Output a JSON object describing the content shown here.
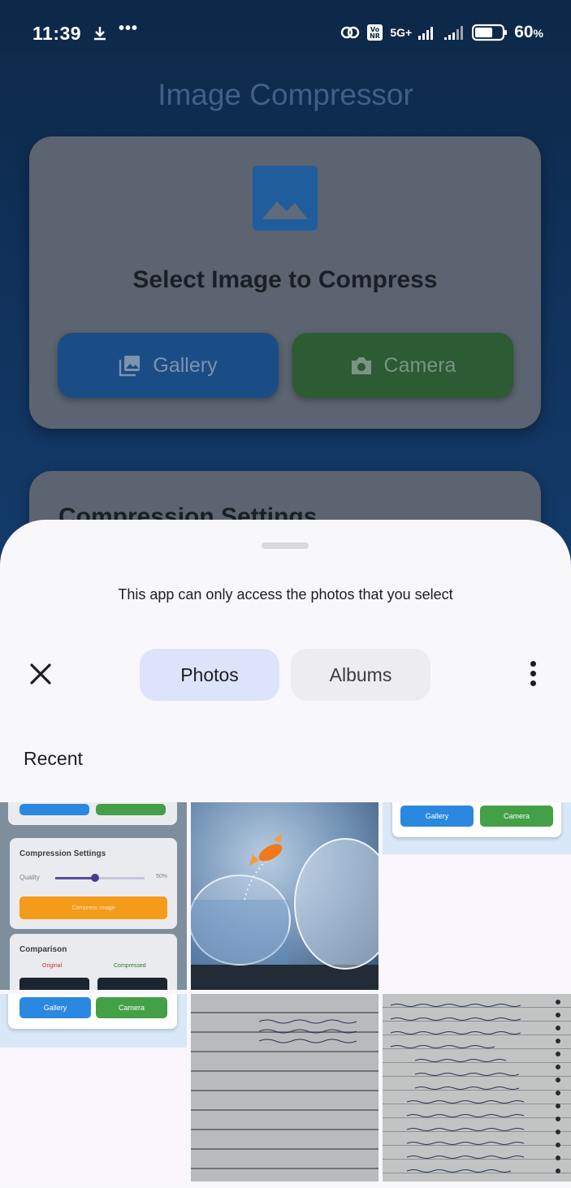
{
  "status_bar": {
    "time": "11:39",
    "dots": "•••",
    "network": "5G+",
    "battery_percent": "60",
    "battery_suffix": "%"
  },
  "app": {
    "title": "Image Compressor",
    "select_title": "Select Image to Compress",
    "gallery_label": "Gallery",
    "camera_label": "Camera",
    "settings_title": "Compression Settings"
  },
  "sheet": {
    "notice": "This app can only access the photos that you select",
    "tabs": [
      {
        "label": "Photos",
        "selected": true
      },
      {
        "label": "Albums",
        "selected": false
      }
    ],
    "section_title": "Recent"
  },
  "thumbs": {
    "t1": {
      "settings_title": "Compression Settings",
      "quality_label": "Quality",
      "quality_value": "50%",
      "compress_label": "Compress Image",
      "comparison_title": "Comparison",
      "original_label": "Original",
      "compressed_label": "Compressed"
    },
    "t3": {
      "gallery": "Gallery",
      "camera": "Camera"
    },
    "t4": {
      "gallery": "Gallery",
      "camera": "Camera"
    }
  },
  "colors": {
    "accent": "#dde3fb",
    "gallery_blue": "#2b88e0",
    "camera_green": "#43a047"
  }
}
